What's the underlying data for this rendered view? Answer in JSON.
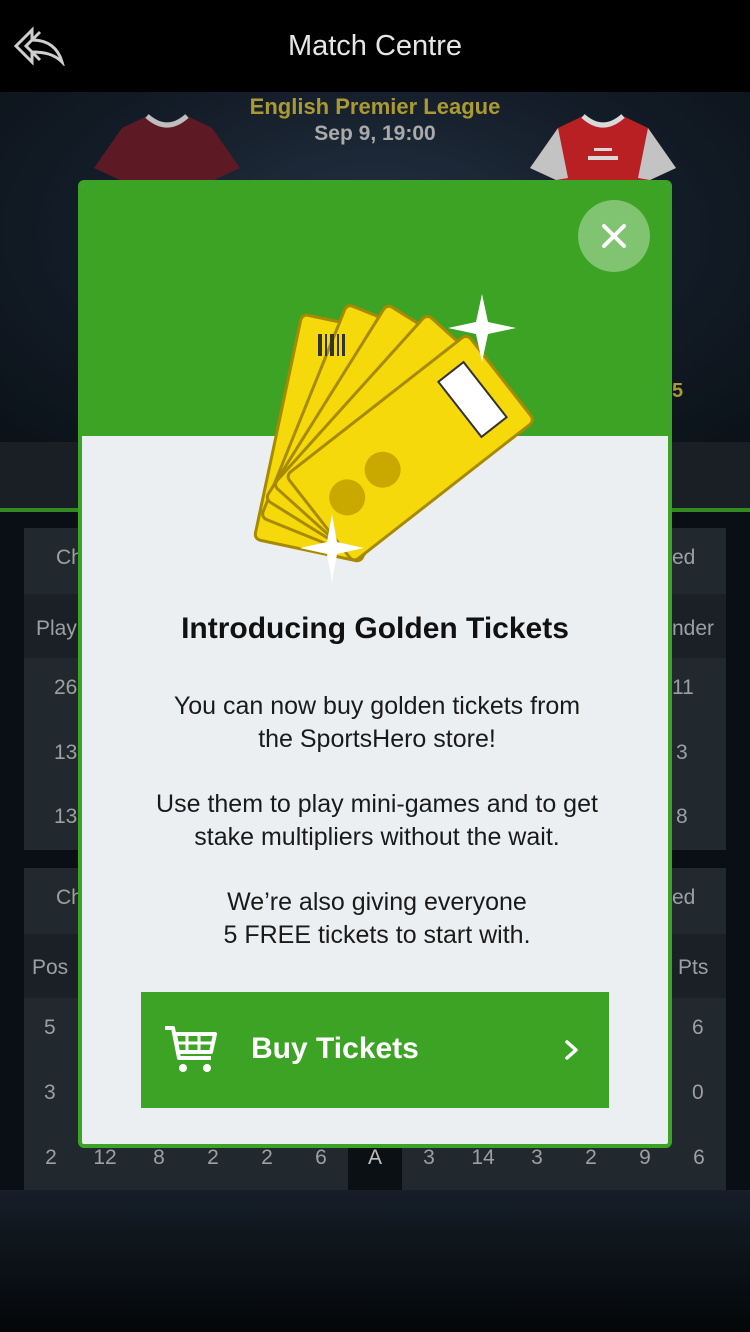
{
  "topbar": {
    "title": "Match Centre",
    "back_icon": "back-arrow-icon"
  },
  "match": {
    "league": "English Premier League",
    "kickoff": "Sep 9, 19:00",
    "score_fragment": "5"
  },
  "background_table1": {
    "header_left": "Ch",
    "header_right": "ed",
    "col_left": "Play",
    "col_right": "nder",
    "rows": [
      {
        "left": "26",
        "right": "11"
      },
      {
        "left": "13",
        "right": "3"
      },
      {
        "left": "13",
        "right": "8"
      }
    ]
  },
  "background_table2": {
    "header_left": "Ch",
    "header_right": "ed",
    "col_left": "Pos",
    "col_right": "Pts",
    "rows": [
      {
        "left": "5",
        "right": "6"
      },
      {
        "left": "3",
        "right": "0"
      }
    ],
    "stand_row": [
      "2",
      "12",
      "8",
      "2",
      "2",
      "6",
      "A",
      "3",
      "14",
      "3",
      "2",
      "9",
      "6"
    ]
  },
  "modal": {
    "close_icon": "close-icon",
    "art": "golden-tickets-icon",
    "title": "Introducing Golden Tickets",
    "para1_line1": "You can now buy golden tickets from",
    "para1_line2": "the SportsHero store!",
    "para2_line1": "Use them to play mini-games and to get",
    "para2_line2": "stake multipliers without the wait.",
    "para3_line1": "We’re also giving everyone",
    "para3_line2": "5 FREE tickets to start with.",
    "button_label": "Buy Tickets",
    "button_icon": "shopping-cart-icon",
    "button_chevron": "chevron-right-icon"
  },
  "colors": {
    "brand_green": "#3ca324",
    "gold_text": "#c9b43a",
    "ticket_yellow": "#f5d90a"
  }
}
